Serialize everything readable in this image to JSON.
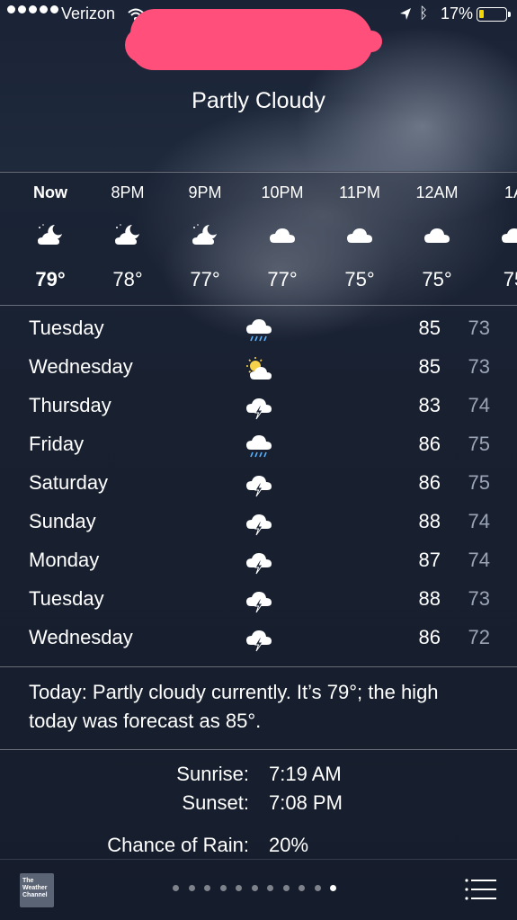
{
  "status_bar": {
    "carrier": "Verizon",
    "battery_pct": "17%",
    "battery_level": 0.17,
    "battery_color": "#f5d800"
  },
  "header": {
    "condition": "Partly Cloudy"
  },
  "hourly": [
    {
      "time": "Now",
      "temp": "79°",
      "icon": "cloud-moon-icon"
    },
    {
      "time": "8PM",
      "temp": "78°",
      "icon": "cloud-moon-icon"
    },
    {
      "time": "9PM",
      "temp": "77°",
      "icon": "cloud-moon-icon"
    },
    {
      "time": "10PM",
      "temp": "77°",
      "icon": "cloud-icon"
    },
    {
      "time": "11PM",
      "temp": "75°",
      "icon": "cloud-icon"
    },
    {
      "time": "12AM",
      "temp": "75°",
      "icon": "cloud-icon"
    },
    {
      "time": "1A",
      "temp": "75",
      "icon": "cloud-icon"
    }
  ],
  "daily": [
    {
      "day": "Tuesday",
      "icon": "rain-cloud-icon",
      "high": "85",
      "low": "73"
    },
    {
      "day": "Wednesday",
      "icon": "sun-cloud-icon",
      "high": "85",
      "low": "73"
    },
    {
      "day": "Thursday",
      "icon": "thunderstorm-icon",
      "high": "83",
      "low": "74"
    },
    {
      "day": "Friday",
      "icon": "rain-cloud-icon",
      "high": "86",
      "low": "75"
    },
    {
      "day": "Saturday",
      "icon": "thunderstorm-icon",
      "high": "86",
      "low": "75"
    },
    {
      "day": "Sunday",
      "icon": "thunderstorm-icon",
      "high": "88",
      "low": "74"
    },
    {
      "day": "Monday",
      "icon": "thunderstorm-icon",
      "high": "87",
      "low": "74"
    },
    {
      "day": "Tuesday",
      "icon": "thunderstorm-icon",
      "high": "88",
      "low": "73"
    },
    {
      "day": "Wednesday",
      "icon": "thunderstorm-icon",
      "high": "86",
      "low": "72"
    }
  ],
  "summary": "Today: Partly cloudy currently. It’s 79°; the high today was forecast as 85°.",
  "details": {
    "sunrise_label": "Sunrise:",
    "sunrise_value": "7:19 AM",
    "sunset_label": "Sunset:",
    "sunset_value": "7:08 PM",
    "rain_label": "Chance of Rain:",
    "rain_value": "20%"
  },
  "footer": {
    "logo_text": "The Weather Channel",
    "page_count": 11,
    "active_page": 10
  }
}
